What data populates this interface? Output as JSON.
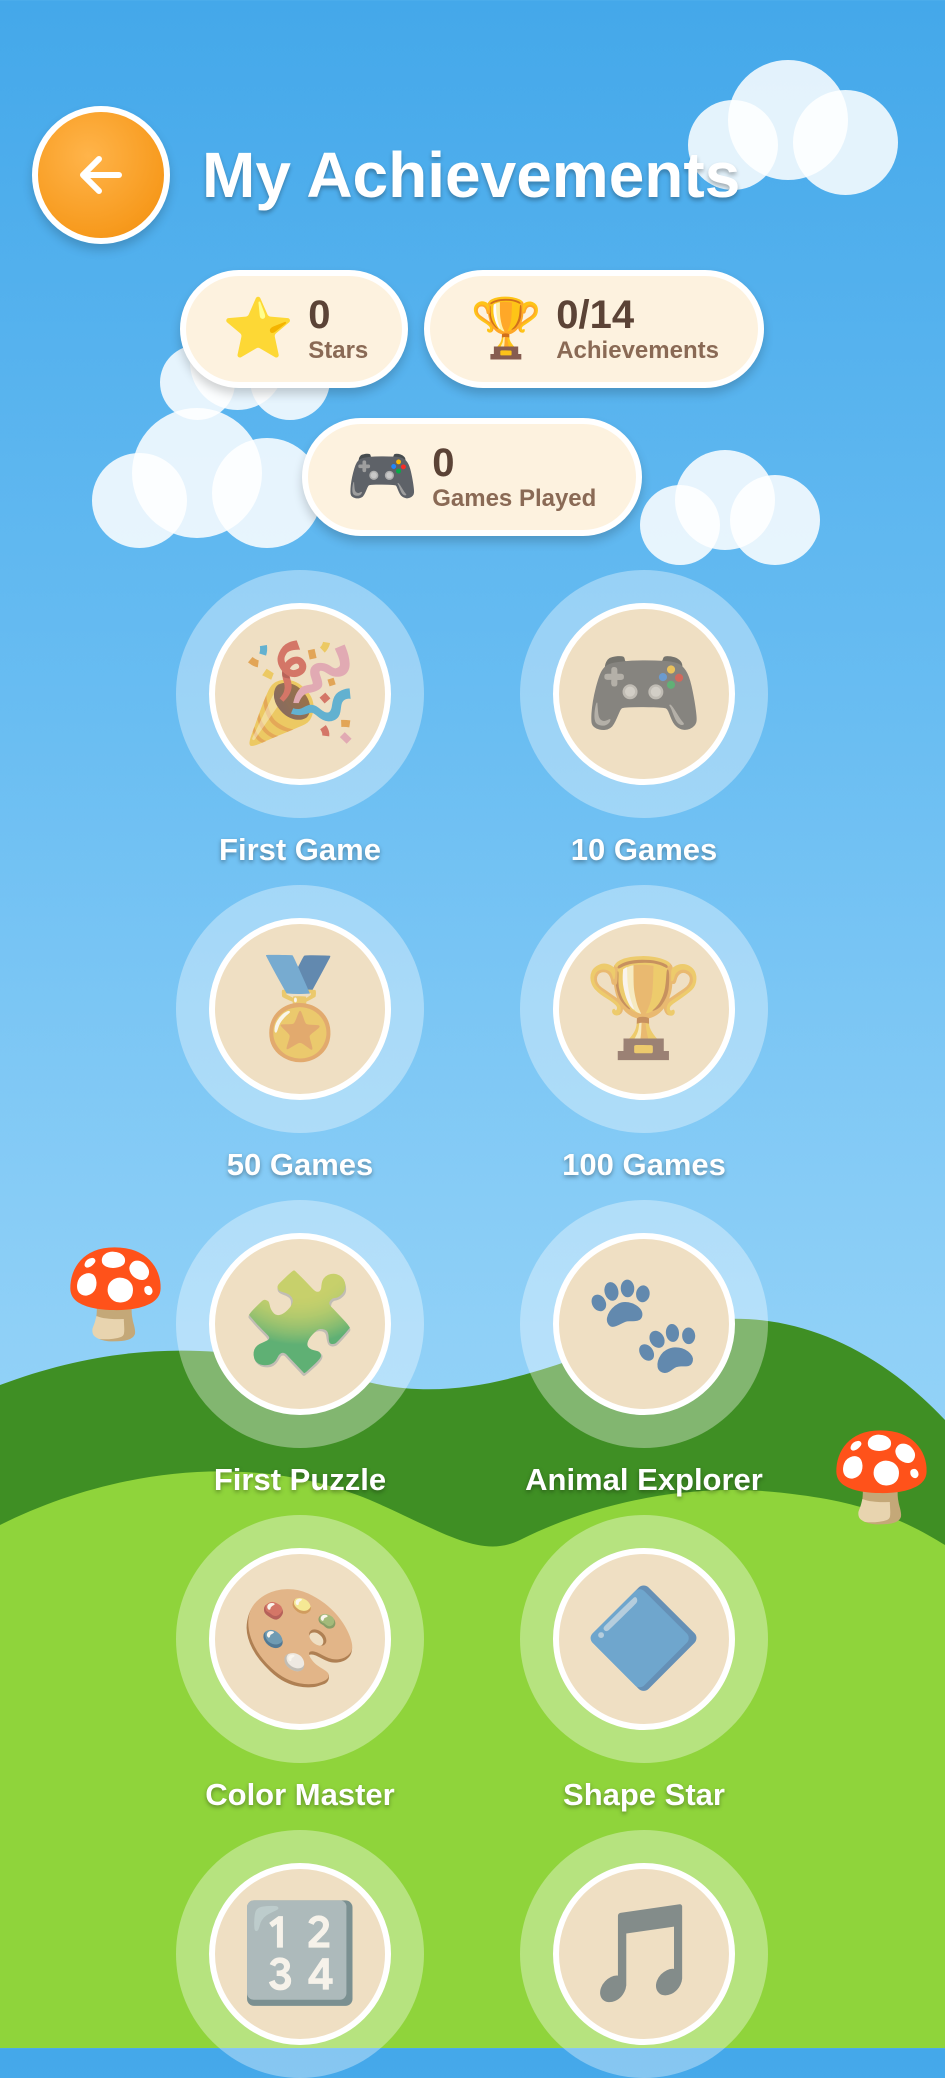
{
  "header": {
    "title": "My Achievements",
    "back_icon": "arrow-left-icon"
  },
  "stats": {
    "stars": {
      "value": "0",
      "label": "Stars",
      "icon": "star-icon",
      "emoji": "⭐"
    },
    "achievements": {
      "value": "0/14",
      "label": "Achievements",
      "icon": "trophy-icon",
      "emoji": "🏆"
    },
    "games_played": {
      "value": "0",
      "label": "Games Played",
      "icon": "game-controller-icon",
      "emoji": "🎮"
    }
  },
  "achievements": [
    {
      "name": "First Game",
      "icon": "party-popper-icon",
      "emoji": "🎉",
      "unlocked": false
    },
    {
      "name": "10 Games",
      "icon": "game-controller-icon",
      "emoji": "🎮",
      "unlocked": false
    },
    {
      "name": "50 Games",
      "icon": "medal-icon",
      "emoji": "🏅",
      "unlocked": false
    },
    {
      "name": "100 Games",
      "icon": "trophy-icon",
      "emoji": "🏆",
      "unlocked": false
    },
    {
      "name": "First Puzzle",
      "icon": "puzzle-piece-icon",
      "emoji": "🧩",
      "unlocked": false
    },
    {
      "name": "Animal Explorer",
      "icon": "paw-prints-icon",
      "emoji": "🐾",
      "unlocked": false
    },
    {
      "name": "Color Master",
      "icon": "palette-icon",
      "emoji": "🎨",
      "unlocked": false
    },
    {
      "name": "Shape Star",
      "icon": "diamond-icon",
      "emoji": "🔷",
      "unlocked": false
    },
    {
      "name": "",
      "icon": "numbers-icon",
      "emoji": "🔢",
      "unlocked": false
    },
    {
      "name": "",
      "icon": "music-note-icon",
      "emoji": "🎵",
      "unlocked": false
    }
  ],
  "decor": {
    "mushroom": "🍄"
  },
  "colors": {
    "sky_top": "#44a8ea",
    "back_button": "#f79a1d",
    "pill_bg": "#fdf2df",
    "badge_locked": "#efdfc3",
    "hill_dark": "#3f8f24",
    "hill_light": "#8fd43b"
  }
}
